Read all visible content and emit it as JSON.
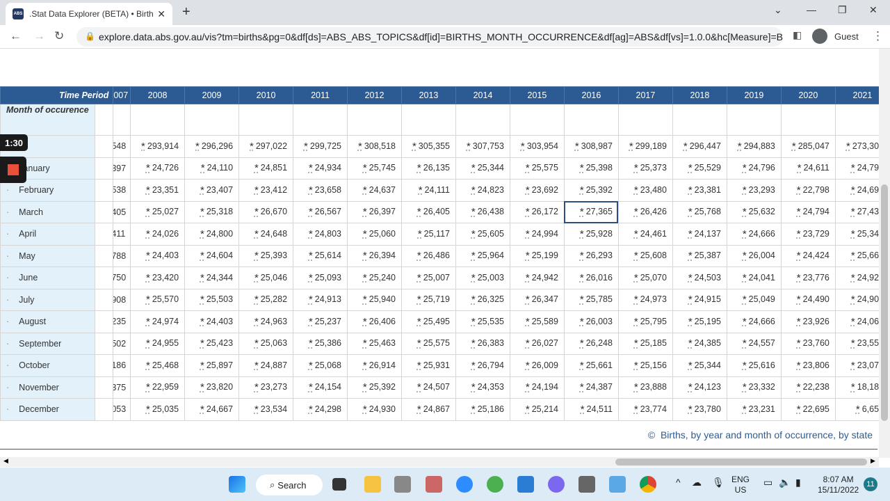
{
  "browser": {
    "tab_title": ".Stat Data Explorer (BETA) • Births, by",
    "favicon": "ABS",
    "url": "explore.data.abs.gov.au/vis?tm=births&pg=0&df[ds]=ABS_ABS_TOPICS&df[id]=BIRTHS_MONTH_OCCURRENCE&df[ag]=ABS&df[vs]=1.0.0&hc[Measure]=B...",
    "profile": "Guest"
  },
  "table": {
    "time_period_label": "Time Period",
    "row_dim_label": "Month of occurence",
    "partial_year": "007",
    "years": [
      "2008",
      "2009",
      "2010",
      "2011",
      "2012",
      "2013",
      "2014",
      "2015",
      "2016",
      "2017",
      "2018",
      "2019",
      "2020",
      "2021"
    ],
    "rows": [
      {
        "label": "",
        "partial": "548",
        "values": [
          "293,914",
          "296,296",
          "297,022",
          "299,725",
          "308,518",
          "305,355",
          "307,753",
          "303,954",
          "308,987",
          "299,189",
          "296,447",
          "294,883",
          "285,047",
          "273,301"
        ]
      },
      {
        "label": "January",
        "partial": "397",
        "values": [
          "24,726",
          "24,110",
          "24,851",
          "24,934",
          "25,745",
          "26,135",
          "25,344",
          "25,575",
          "25,398",
          "25,373",
          "25,529",
          "24,796",
          "24,611",
          "24,793"
        ]
      },
      {
        "label": "February",
        "partial": "538",
        "values": [
          "23,351",
          "23,407",
          "23,412",
          "23,658",
          "24,637",
          "24,111",
          "24,823",
          "23,692",
          "25,392",
          "23,480",
          "23,381",
          "23,293",
          "22,798",
          "24,695"
        ]
      },
      {
        "label": "March",
        "partial": "405",
        "values": [
          "25,027",
          "25,318",
          "26,670",
          "26,567",
          "26,397",
          "26,405",
          "26,438",
          "26,172",
          "27,365",
          "26,426",
          "25,768",
          "25,632",
          "24,794",
          "27,433"
        ]
      },
      {
        "label": "April",
        "partial": "411",
        "values": [
          "24,026",
          "24,800",
          "24,648",
          "24,803",
          "25,060",
          "25,117",
          "25,605",
          "24,994",
          "25,928",
          "24,461",
          "24,137",
          "24,666",
          "23,729",
          "25,342"
        ]
      },
      {
        "label": "May",
        "partial": "788",
        "values": [
          "24,403",
          "24,604",
          "25,393",
          "25,614",
          "26,394",
          "26,486",
          "25,964",
          "25,199",
          "26,293",
          "25,608",
          "25,387",
          "26,004",
          "24,424",
          "25,669"
        ]
      },
      {
        "label": "June",
        "partial": "750",
        "values": [
          "23,420",
          "24,344",
          "25,046",
          "25,093",
          "25,240",
          "25,007",
          "25,003",
          "24,942",
          "26,016",
          "25,070",
          "24,503",
          "24,041",
          "23,776",
          "24,928"
        ]
      },
      {
        "label": "July",
        "partial": "908",
        "values": [
          "25,570",
          "25,503",
          "25,282",
          "24,913",
          "25,940",
          "25,719",
          "26,325",
          "26,347",
          "25,785",
          "24,973",
          "24,915",
          "25,049",
          "24,490",
          "24,905"
        ]
      },
      {
        "label": "August",
        "partial": "235",
        "values": [
          "24,974",
          "24,403",
          "24,963",
          "25,237",
          "26,406",
          "25,495",
          "25,535",
          "25,589",
          "26,003",
          "25,795",
          "25,195",
          "24,666",
          "23,926",
          "24,060"
        ]
      },
      {
        "label": "September",
        "partial": "502",
        "values": [
          "24,955",
          "25,423",
          "25,063",
          "25,386",
          "25,463",
          "25,575",
          "26,383",
          "26,027",
          "26,248",
          "25,185",
          "24,385",
          "24,557",
          "23,760",
          "23,558"
        ]
      },
      {
        "label": "October",
        "partial": "186",
        "values": [
          "25,468",
          "25,897",
          "24,887",
          "25,068",
          "26,914",
          "25,931",
          "26,794",
          "26,009",
          "25,661",
          "25,156",
          "25,344",
          "25,616",
          "23,806",
          "23,073"
        ]
      },
      {
        "label": "November",
        "partial": "375",
        "values": [
          "22,959",
          "23,820",
          "23,273",
          "24,154",
          "25,392",
          "24,507",
          "24,353",
          "24,194",
          "24,387",
          "23,888",
          "24,123",
          "23,332",
          "22,238",
          "18,186"
        ]
      },
      {
        "label": "December",
        "partial": "053",
        "values": [
          "25,035",
          "24,667",
          "23,534",
          "24,298",
          "24,930",
          "24,867",
          "25,186",
          "25,214",
          "24,511",
          "23,774",
          "23,780",
          "23,231",
          "22,695",
          "6,659"
        ]
      }
    ],
    "flag": "*",
    "selected": {
      "row": "March",
      "year": "2016"
    }
  },
  "overlay": {
    "timer": "1:30"
  },
  "footer": {
    "copyright": "©",
    "source_link": "Births, by year and month of occurrence, by state"
  },
  "taskbar": {
    "search": "Search",
    "lang": "ENG",
    "region": "US",
    "time": "8:07 AM",
    "date": "15/11/2022",
    "notifications": "11"
  },
  "colors": {
    "header": "#2c5b94",
    "label_bg": "#e3f1fb",
    "accent": "#2c5b94"
  }
}
